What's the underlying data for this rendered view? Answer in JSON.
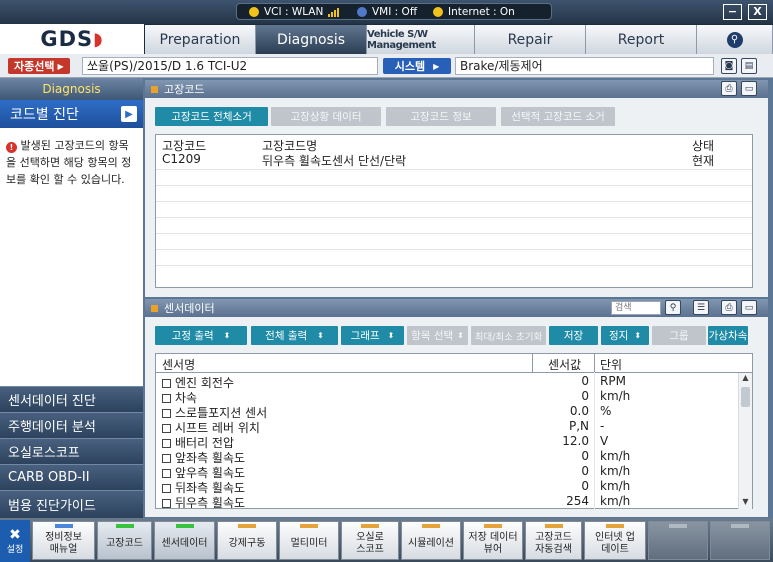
{
  "status": {
    "vci": "VCI : WLAN",
    "vmi": "VMI : Off",
    "internet": "Internet : On"
  },
  "window_controls": {
    "minimize": "−",
    "close": "X"
  },
  "logo": "GDS",
  "nav_tabs": [
    {
      "label": "Preparation"
    },
    {
      "label": "Diagnosis"
    },
    {
      "label": "Vehicle S/W Management"
    },
    {
      "label": "Repair"
    },
    {
      "label": "Report"
    }
  ],
  "vehicle": {
    "select_label": "자종선택",
    "value": "쏘울(PS)/2015/D 1.6 TCI-U2",
    "system_label": "시스템",
    "system_value": "Brake/제동제어"
  },
  "sidebar": {
    "header": "Diagnosis",
    "selected": "코드별 진단",
    "message": "발생된 고장코드의 항목을 선택하면 해당 항목의 정보를 확인 할 수 있습니다.",
    "items": [
      {
        "label": "센서데이터 진단"
      },
      {
        "label": "주행데이터 분석"
      },
      {
        "label": "오실로스코프"
      },
      {
        "label": "CARB OBD-II"
      },
      {
        "label": "범용 진단가이드"
      }
    ]
  },
  "dtc_panel": {
    "title": "고장코드",
    "buttons": [
      {
        "label": "고장코드 전체소거",
        "enabled": true
      },
      {
        "label": "고장상황 데이터",
        "enabled": false
      },
      {
        "label": "고장코드 정보",
        "enabled": false
      },
      {
        "label": "선택적 고장코드 소거",
        "enabled": false
      }
    ],
    "columns": [
      "고장코드",
      "고장코드명",
      "상태"
    ],
    "rows": [
      {
        "code": "C1209",
        "name": "뒤우측 휠속도센서 단선/단락",
        "status": "현재"
      }
    ]
  },
  "sensor_panel": {
    "title": "센서데이터",
    "search_placeholder": "검색",
    "buttons": [
      {
        "label": "고정 출력",
        "enabled": true
      },
      {
        "label": "전체 출력",
        "enabled": true
      },
      {
        "label": "그래프",
        "enabled": true
      },
      {
        "label": "항목 선택",
        "enabled": false
      },
      {
        "label": "최대/최소 초기화",
        "enabled": false
      },
      {
        "label": "저장",
        "enabled": true
      },
      {
        "label": "정지",
        "enabled": true
      },
      {
        "label": "그룹",
        "enabled": false
      },
      {
        "label": "가상차속",
        "enabled": true
      }
    ],
    "columns": [
      "센서명",
      "센서값",
      "단위"
    ],
    "rows": [
      {
        "name": "엔진 회전수",
        "value": "0",
        "unit": "RPM"
      },
      {
        "name": "차속",
        "value": "0",
        "unit": "km/h"
      },
      {
        "name": "스로틀포지션 센서",
        "value": "0.0",
        "unit": "%"
      },
      {
        "name": "시프트 레버 위치",
        "value": "P,N",
        "unit": "-"
      },
      {
        "name": "배터리 전압",
        "value": "12.0",
        "unit": "V"
      },
      {
        "name": "앞좌측 휠속도",
        "value": "0",
        "unit": "km/h"
      },
      {
        "name": "앞우측 휠속도",
        "value": "0",
        "unit": "km/h"
      },
      {
        "name": "뒤좌측 휠속도",
        "value": "0",
        "unit": "km/h"
      },
      {
        "name": "뒤우측 휠속도",
        "value": "254",
        "unit": "km/h"
      }
    ]
  },
  "bottom_bar": {
    "settings": "설정",
    "buttons": [
      {
        "label": "정비정보 매뉴얼",
        "state": "normal"
      },
      {
        "label": "고장코드",
        "state": "active"
      },
      {
        "label": "센서데이터",
        "state": "active"
      },
      {
        "label": "강제구동",
        "state": "normal"
      },
      {
        "label": "멀티미터",
        "state": "normal"
      },
      {
        "label": "오실로 스코프",
        "state": "normal"
      },
      {
        "label": "시뮬레이션",
        "state": "normal"
      },
      {
        "label": "저장 데이터 뷰어",
        "state": "normal"
      },
      {
        "label": "고장코드 자동검색",
        "state": "normal"
      },
      {
        "label": "인터넷 업데이트",
        "state": "normal"
      },
      {
        "label": "",
        "state": "off"
      },
      {
        "label": "",
        "state": "off"
      },
      {
        "label": "",
        "state": "off"
      }
    ]
  },
  "colors": {
    "accent": "#1f8ba6",
    "nav_active": "#2a3d53",
    "sidebar_selected": "#2e6ec7",
    "red_button": "#c4372b",
    "status_yellow": "#f1c21b"
  }
}
